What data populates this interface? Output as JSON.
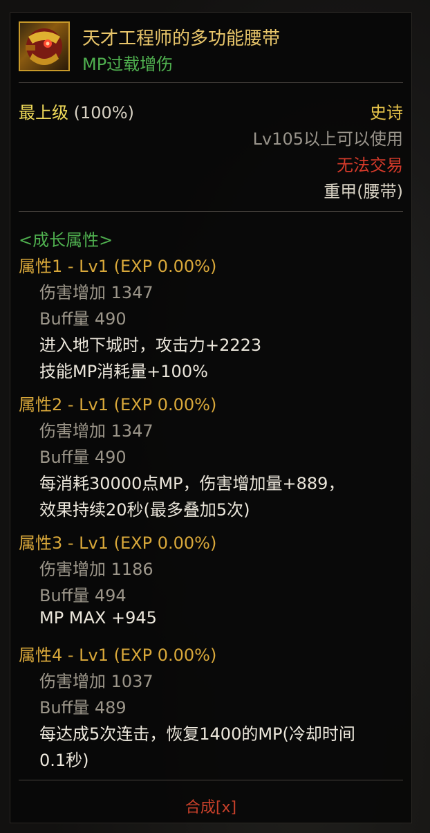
{
  "item": {
    "name": "天才工程师的多功能腰带",
    "subtitle": "MP过载增伤",
    "icon": "belt-icon"
  },
  "info": {
    "grade_label": "最上级",
    "grade_pct": "(100%)",
    "rarity": "史诗",
    "level_req": "Lv105以上可以使用",
    "trade": "无法交易",
    "slot": "重甲(腰带)"
  },
  "growth": {
    "section_title": "<成长属性>",
    "attributes": [
      {
        "header": "属性1 - Lv1 (EXP 0.00%)",
        "damage": "伤害增加   1347",
        "buff": "Buff量   490",
        "effects": [
          "进入地下城时，攻击力+2223",
          "技能MP消耗量+100%"
        ]
      },
      {
        "header": "属性2 - Lv1 (EXP 0.00%)",
        "damage": "伤害增加   1347",
        "buff": "Buff量   490",
        "effects": [
          "每消耗30000点MP，伤害增加量+889，",
          "效果持续20秒(最多叠加5次)"
        ]
      },
      {
        "header": "属性3 - Lv1 (EXP 0.00%)",
        "damage": "伤害增加   1186",
        "buff": "Buff量   494",
        "effects": [
          "MP MAX +945"
        ]
      },
      {
        "header": "属性4 - Lv1 (EXP 0.00%)",
        "damage": "伤害增加   1037",
        "buff": "Buff量   489",
        "effects": [
          "每达成5次连击，恢复1400的MP(冷却时间",
          "0.1秒)"
        ]
      }
    ]
  },
  "footer": {
    "compose_label": "合成[x]"
  },
  "colors": {
    "item_name": "#e8c56a",
    "subtitle": "#4fb04f",
    "attr_header": "#d9a83a",
    "trade": "#d43a2a"
  }
}
